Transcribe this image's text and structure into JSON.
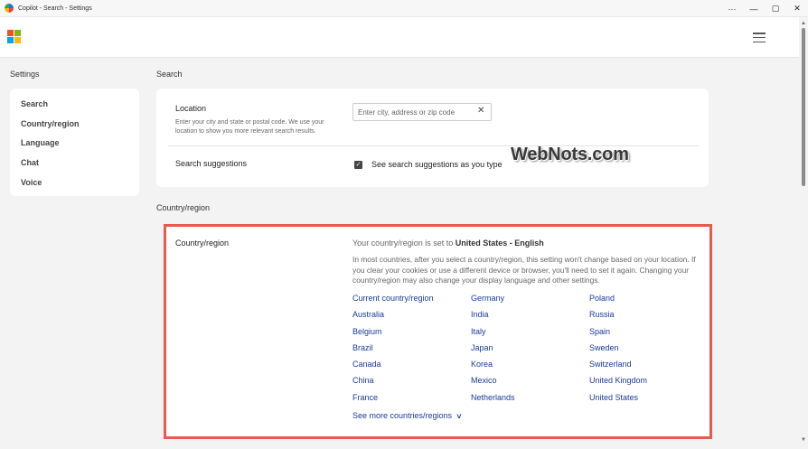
{
  "window": {
    "title": "Copilot - Search - Settings",
    "controls": {
      "more": "···",
      "minimize": "—",
      "maximize": "▢",
      "close": "✕"
    }
  },
  "nav": {
    "heading": "Settings",
    "items": [
      {
        "label": "Search"
      },
      {
        "label": "Country/region"
      },
      {
        "label": "Language"
      },
      {
        "label": "Chat"
      },
      {
        "label": "Voice"
      }
    ]
  },
  "search_section": {
    "heading": "Search",
    "location": {
      "title": "Location",
      "description": "Enter your city and state or postal code. We use your location to show you more relevant search results.",
      "placeholder": "Enter city, address or zip code",
      "value": ""
    },
    "suggestions": {
      "title": "Search suggestions",
      "checkbox_label": "See search suggestions as you type",
      "checked": true
    }
  },
  "watermark": "WebNots.com",
  "country_section": {
    "heading": "Country/region",
    "title": "Country/region",
    "status_prefix": "Your country/region is set to ",
    "status_value": "United States - English",
    "description": "In most countries, after you select a country/region, this setting won't change based on your location. If you clear your cookies or use a different device or browser, you'll need to set it again. Changing your country/region may also change your display language and other settings.",
    "countries": [
      "Current country/region",
      "Germany",
      "Poland",
      "Australia",
      "India",
      "Russia",
      "Belgium",
      "Italy",
      "Spain",
      "Brazil",
      "Japan",
      "Sweden",
      "Canada",
      "Korea",
      "Switzerland",
      "China",
      "Mexico",
      "United Kingdom",
      "France",
      "Netherlands",
      "United States"
    ],
    "see_more": "See more countries/regions"
  },
  "colors": {
    "link": "#1a3a9a",
    "highlight_border": "#e85a4f",
    "background": "#f3f3f3"
  }
}
